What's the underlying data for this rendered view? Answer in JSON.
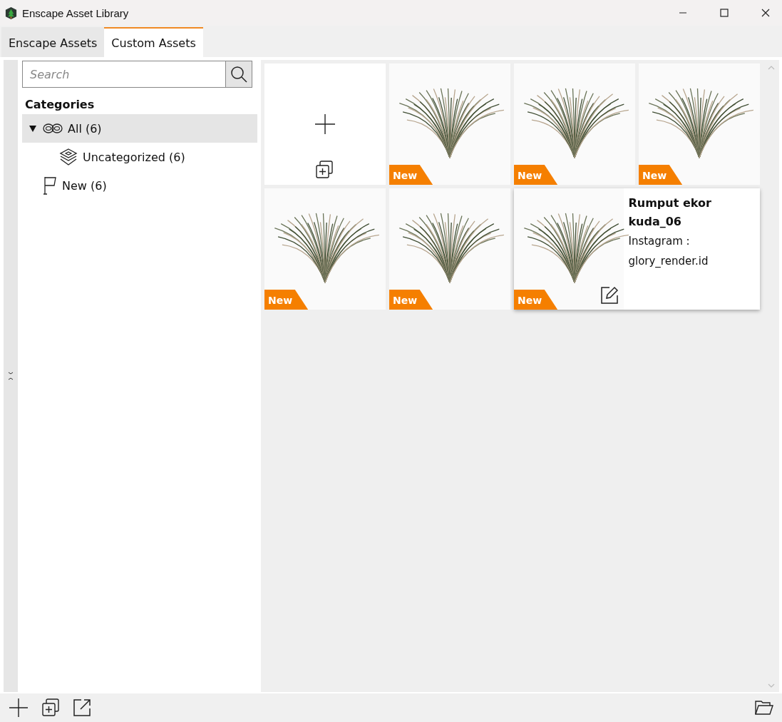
{
  "window": {
    "title": "Enscape Asset Library"
  },
  "tabs": [
    {
      "label": "Enscape Assets",
      "selected": false
    },
    {
      "label": "Custom Assets",
      "selected": true
    }
  ],
  "search": {
    "placeholder": "Search"
  },
  "sidebar": {
    "heading": "Categories",
    "tree": [
      {
        "label": "All (6)",
        "kind": "all",
        "selected": true,
        "expanded": true,
        "children": [
          {
            "label": "Uncategorized (6)",
            "kind": "stack",
            "selected": false
          }
        ]
      },
      {
        "label": "New (6)",
        "kind": "flag",
        "selected": false
      }
    ]
  },
  "assets": [
    {
      "kind": "add"
    },
    {
      "kind": "asset",
      "badge": "New",
      "expanded": false
    },
    {
      "kind": "asset",
      "badge": "New",
      "expanded": false
    },
    {
      "kind": "asset",
      "badge": "New",
      "expanded": false
    },
    {
      "kind": "asset",
      "badge": "New",
      "expanded": false
    },
    {
      "kind": "asset",
      "badge": "New",
      "expanded": false
    },
    {
      "kind": "asset",
      "badge": "New",
      "expanded": true,
      "name": "Rumput ekor kuda_06",
      "info": [
        "Instagram :",
        "glory_render.id"
      ]
    }
  ]
}
